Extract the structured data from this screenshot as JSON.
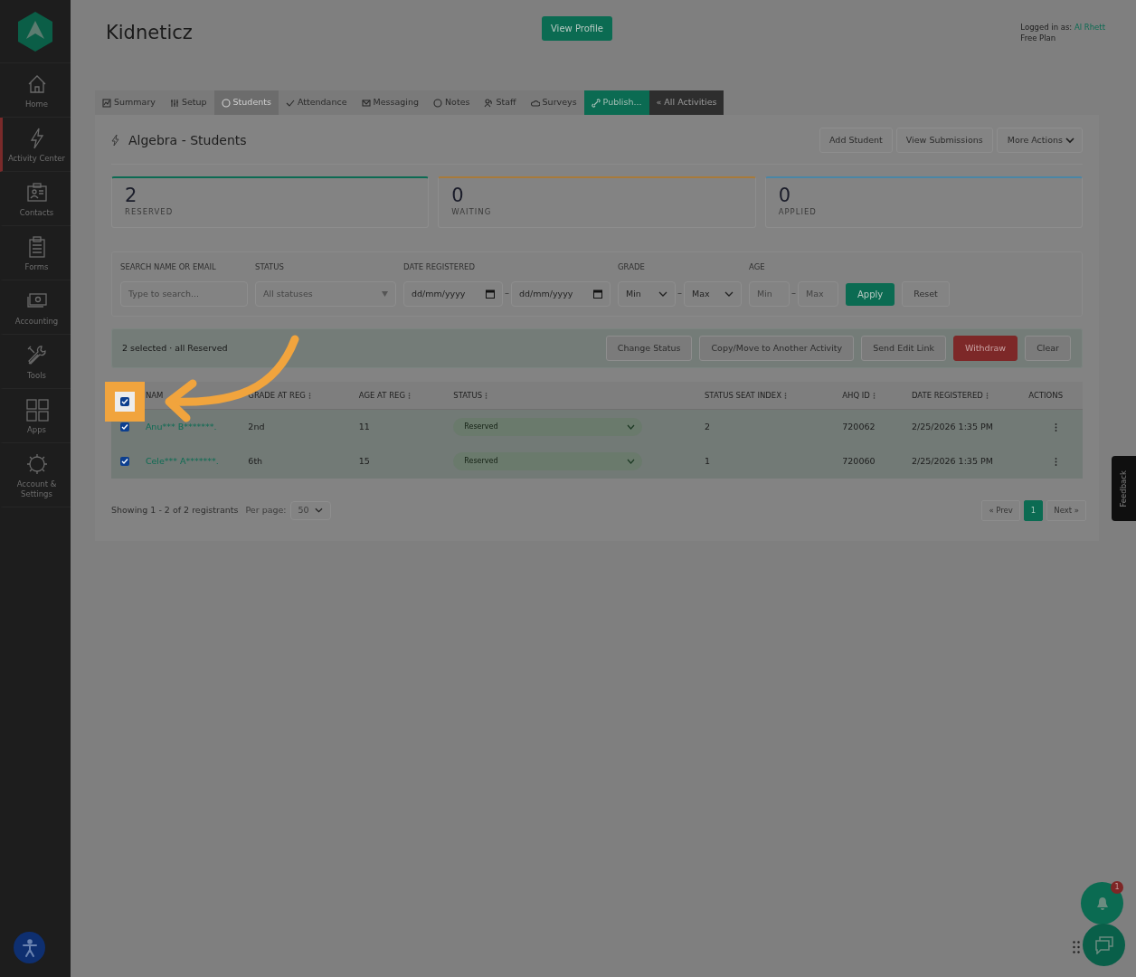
{
  "sidebar": {
    "items": [
      {
        "label": "Home",
        "selected": false
      },
      {
        "label": "Activity Center",
        "selected": true
      },
      {
        "label": "Contacts",
        "selected": false
      },
      {
        "label": "Forms",
        "selected": false
      },
      {
        "label": "Accounting",
        "selected": false
      },
      {
        "label": "Tools",
        "selected": false
      },
      {
        "label": "Apps",
        "selected": false
      },
      {
        "label": "Account & Settings",
        "selected": false
      }
    ]
  },
  "header": {
    "title": "Kidneticz",
    "profile_button": "View Profile",
    "logged_in_label": "Logged in as:",
    "user": "Al Rhett",
    "plan": "Free Plan"
  },
  "tabs": [
    {
      "label": "Summary",
      "kind": "tab",
      "selected": false
    },
    {
      "label": "Setup",
      "kind": "tab",
      "selected": false
    },
    {
      "label": "Students",
      "kind": "tab",
      "selected": true
    },
    {
      "label": "Attendance",
      "kind": "tab",
      "selected": false
    },
    {
      "label": "Messaging",
      "kind": "tab",
      "selected": false
    },
    {
      "label": "Notes",
      "kind": "tab",
      "selected": false
    },
    {
      "label": "Staff",
      "kind": "tab",
      "selected": false
    },
    {
      "label": "Surveys",
      "kind": "tab",
      "selected": false
    },
    {
      "label": "Publish...",
      "kind": "publish",
      "selected": false
    },
    {
      "label": "« All Activities",
      "kind": "back",
      "selected": false
    }
  ],
  "panel": {
    "title": "Algebra - Students",
    "actions": [
      "Add Student",
      "View Submissions"
    ],
    "more_actions": "More Actions"
  },
  "stats": [
    {
      "value": "2",
      "label": "RESERVED",
      "color": "#0c6b53"
    },
    {
      "value": "0",
      "label": "WAITING",
      "color": "#a87a3a"
    },
    {
      "value": "0",
      "label": "APPLIED",
      "color": "#4a86a6"
    }
  ],
  "filters": {
    "search_label": "SEARCH NAME OR EMAIL",
    "search_placeholder": "Type to search...",
    "status_label": "STATUS",
    "status_placeholder": "All statuses",
    "date_label": "DATE REGISTERED",
    "date_from": "dd/mm/yyyy",
    "date_separator": "–",
    "date_to": "dd/mm/yyyy",
    "grade_label": "GRADE",
    "grade_min": "Min",
    "grade_separator": "–",
    "grade_max": "Max",
    "age_label": "AGE",
    "age_min_placeholder": "Min",
    "age_separator": "–",
    "age_max_placeholder": "Max",
    "apply": "Apply",
    "reset": "Reset"
  },
  "selection_bar": {
    "text": "2 selected · all Reserved",
    "buttons": [
      {
        "label": "Change Status",
        "kind": "plain"
      },
      {
        "label": "Copy/Move to Another Activity",
        "kind": "plain"
      },
      {
        "label": "Send Edit Link",
        "kind": "plain"
      },
      {
        "label": "Withdraw",
        "kind": "danger"
      },
      {
        "label": "Clear",
        "kind": "plain"
      }
    ]
  },
  "table": {
    "select_all_checked": true,
    "columns": [
      {
        "label": "NAM",
        "sortable": false
      },
      {
        "label": "GRADE AT REG",
        "sortable": true
      },
      {
        "label": "AGE AT REG",
        "sortable": true
      },
      {
        "label": "STATUS",
        "sortable": true
      },
      {
        "label": "STATUS SEAT INDEX",
        "sortable": true
      },
      {
        "label": "AHQ ID",
        "sortable": true
      },
      {
        "label": "DATE REGISTERED",
        "sortable": true
      },
      {
        "label": "ACTIONS",
        "sortable": false
      }
    ],
    "rows": [
      {
        "checked": true,
        "name": "Anu*** B*******.",
        "grade": "2nd",
        "age": "11",
        "status": "Reserved",
        "seat_index": "2",
        "ahq_id": "720062",
        "date": "2/25/2026 1:35 PM"
      },
      {
        "checked": true,
        "name": "Cele*** A*******.",
        "grade": "6th",
        "age": "15",
        "status": "Reserved",
        "seat_index": "1",
        "ahq_id": "720060",
        "date": "2/25/2026 1:35 PM"
      }
    ]
  },
  "footer": {
    "showing": "Showing 1 - 2 of 2 registrants",
    "per_page_label": "Per page:",
    "per_page": "50",
    "pages": [
      {
        "label": "« Prev",
        "selected": false
      },
      {
        "label": "1",
        "selected": true
      },
      {
        "label": "Next »",
        "selected": false
      }
    ]
  },
  "feedback_tab": "Feedback",
  "notifications": {
    "count": "1"
  }
}
